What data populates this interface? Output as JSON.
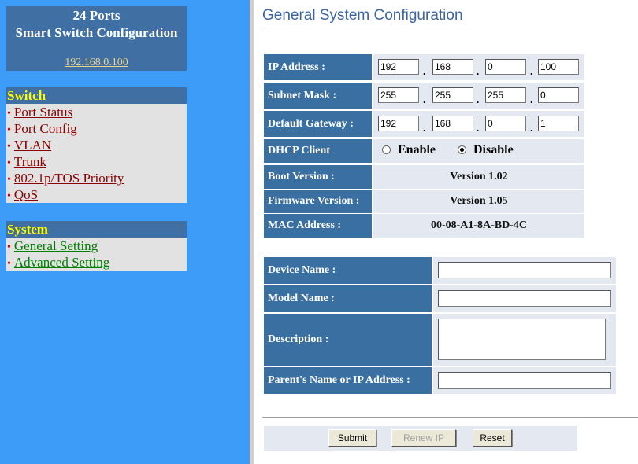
{
  "nav": {
    "header": {
      "line1": "24 Ports",
      "line2": "Smart Switch Configuration",
      "ip": "192.168.0.100"
    },
    "switch": {
      "title": "Switch",
      "items": [
        {
          "label": "Port Status"
        },
        {
          "label": "Port Config"
        },
        {
          "label": "VLAN"
        },
        {
          "label": "Trunk"
        },
        {
          "label": "802.1p/TOS Priority"
        },
        {
          "label": "QoS"
        }
      ]
    },
    "system": {
      "title": "System",
      "items": [
        {
          "label": "General Setting"
        },
        {
          "label": "Advanced Setting"
        }
      ]
    },
    "bullet": "•"
  },
  "page": {
    "title": "General System Configuration",
    "network": {
      "ip_label": "IP Address :",
      "ip": [
        "192",
        "168",
        "0",
        "100"
      ],
      "mask_label": "Subnet Mask :",
      "mask": [
        "255",
        "255",
        "255",
        "0"
      ],
      "gateway_label": "Default Gateway :",
      "gateway": [
        "192",
        "168",
        "0",
        "1"
      ],
      "dot": ".",
      "dhcp_label": "DHCP Client",
      "dhcp_enable": "Enable",
      "dhcp_disable": "Disable",
      "dhcp_selected": "Disable",
      "boot_label": "Boot Version :",
      "boot_value": "Version 1.02",
      "fw_label": "Firmware Version :",
      "fw_value": "Version 1.05",
      "mac_label": "MAC Address :",
      "mac_value": "00-08-A1-8A-BD-4C"
    },
    "device": {
      "name_label": "Device Name :",
      "name_value": "",
      "model_label": "Model Name :",
      "model_value": "",
      "desc_label": "Description :",
      "desc_value": "",
      "parent_label": "Parent's Name or IP Address :",
      "parent_value": ""
    },
    "buttons": {
      "submit": "Submit",
      "renew": "Renew IP",
      "reset": "Reset"
    }
  },
  "colors": {
    "nav_bg": "#3d9cf7",
    "header_bg": "#3f6fa3",
    "label_bg": "#3a6fa1",
    "value_bg": "#e4e9f1",
    "title": "#3d64a2"
  }
}
